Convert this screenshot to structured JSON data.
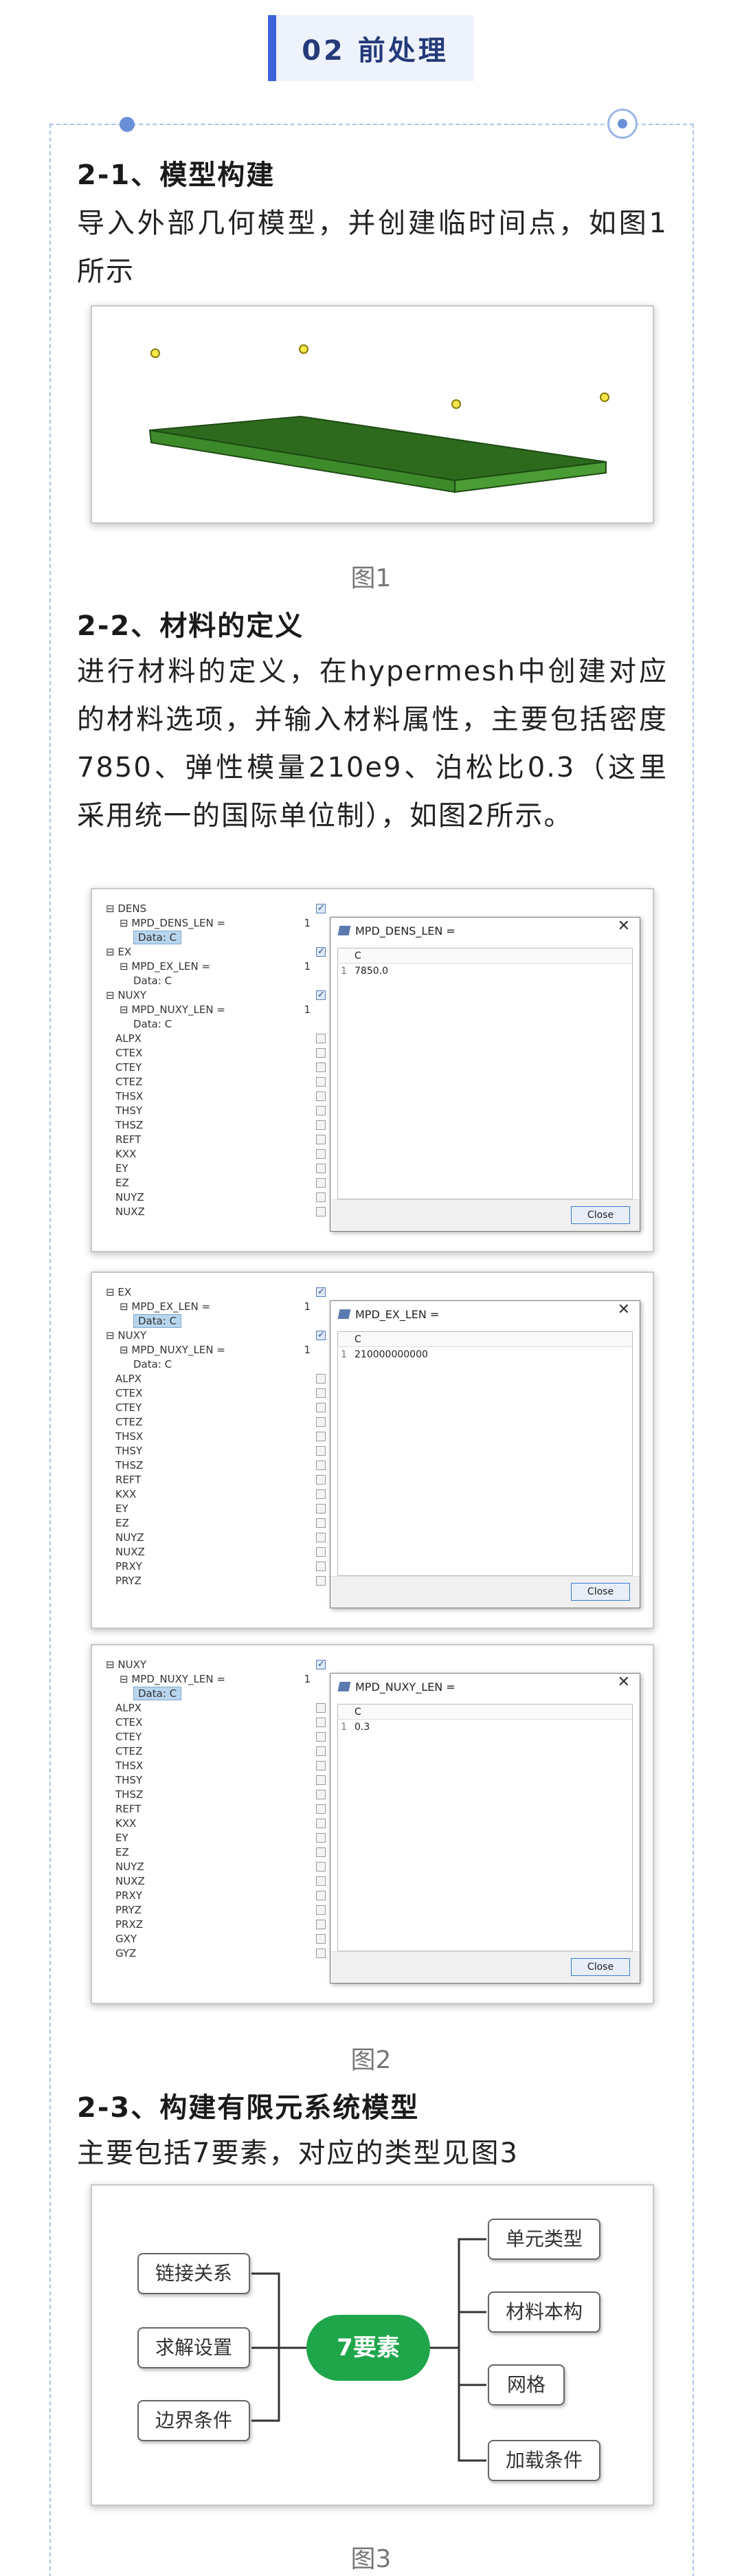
{
  "header": {
    "title": "02 前处理"
  },
  "sections": [
    {
      "heading": "2-1、模型构建",
      "text": "导入外部几何模型，并创建临时间点，如图1所示"
    },
    {
      "heading": "2-2、材料的定义",
      "text": "进行材料的定义，在hypermesh中创建对应的材料选项，并输入材料属性，主要包括密度7850、弹性模量210e9、泊松比0.3（这里采用统一的国际单位制），如图2所示。"
    },
    {
      "heading": "2-3、构建有限元系统模型",
      "text": "主要包括7要素，对应的类型见图3"
    }
  ],
  "captions": {
    "fig1": "图1",
    "fig2": "图2",
    "fig3": "图3"
  },
  "fig2": {
    "panels": [
      {
        "tree": [
          {
            "label": "DENS",
            "indent": 0,
            "exp": "⊟",
            "check": true
          },
          {
            "label": "MPD_DENS_LEN =",
            "indent": 1,
            "exp": "⊟",
            "val": "1"
          },
          {
            "label": "Data: C",
            "indent": 2,
            "sel": true
          },
          {
            "label": "EX",
            "indent": 0,
            "exp": "⊟",
            "check": true
          },
          {
            "label": "MPD_EX_LEN =",
            "indent": 1,
            "exp": "⊟",
            "val": "1"
          },
          {
            "label": "Data: C",
            "indent": 2
          },
          {
            "label": "NUXY",
            "indent": 0,
            "exp": "⊟",
            "check": true
          },
          {
            "label": "MPD_NUXY_LEN =",
            "indent": 1,
            "exp": "⊟",
            "val": "1"
          },
          {
            "label": "Data: C",
            "indent": 2
          },
          {
            "label": "ALPX",
            "indent": 0,
            "check": false
          },
          {
            "label": "CTEX",
            "indent": 0,
            "check": false
          },
          {
            "label": "CTEY",
            "indent": 0,
            "check": false
          },
          {
            "label": "CTEZ",
            "indent": 0,
            "check": false
          },
          {
            "label": "THSX",
            "indent": 0,
            "check": false
          },
          {
            "label": "THSY",
            "indent": 0,
            "check": false
          },
          {
            "label": "THSZ",
            "indent": 0,
            "check": false
          },
          {
            "label": "REFT",
            "indent": 0,
            "check": false
          },
          {
            "label": "KXX",
            "indent": 0,
            "check": false
          },
          {
            "label": "EY",
            "indent": 0,
            "check": false
          },
          {
            "label": "EZ",
            "indent": 0,
            "check": false
          },
          {
            "label": "NUYZ",
            "indent": 0,
            "check": false
          },
          {
            "label": "NUXZ",
            "indent": 0,
            "check": false
          }
        ],
        "dialog": {
          "title": "MPD_DENS_LEN =",
          "col": "C",
          "row_index": "1",
          "value": "7850.0",
          "close": "Close"
        }
      },
      {
        "tree": [
          {
            "label": "EX",
            "indent": 0,
            "exp": "⊟",
            "check": true
          },
          {
            "label": "MPD_EX_LEN =",
            "indent": 1,
            "exp": "⊟",
            "val": "1"
          },
          {
            "label": "Data: C",
            "indent": 2,
            "sel": true
          },
          {
            "label": "NUXY",
            "indent": 0,
            "exp": "⊟",
            "check": true
          },
          {
            "label": "MPD_NUXY_LEN =",
            "indent": 1,
            "exp": "⊟",
            "val": "1"
          },
          {
            "label": "Data: C",
            "indent": 2
          },
          {
            "label": "ALPX",
            "indent": 0,
            "check": false
          },
          {
            "label": "CTEX",
            "indent": 0,
            "check": false
          },
          {
            "label": "CTEY",
            "indent": 0,
            "check": false
          },
          {
            "label": "CTEZ",
            "indent": 0,
            "check": false
          },
          {
            "label": "THSX",
            "indent": 0,
            "check": false
          },
          {
            "label": "THSY",
            "indent": 0,
            "check": false
          },
          {
            "label": "THSZ",
            "indent": 0,
            "check": false
          },
          {
            "label": "REFT",
            "indent": 0,
            "check": false
          },
          {
            "label": "KXX",
            "indent": 0,
            "check": false
          },
          {
            "label": "EY",
            "indent": 0,
            "check": false
          },
          {
            "label": "EZ",
            "indent": 0,
            "check": false
          },
          {
            "label": "NUYZ",
            "indent": 0,
            "check": false
          },
          {
            "label": "NUXZ",
            "indent": 0,
            "check": false
          },
          {
            "label": "PRXY",
            "indent": 0,
            "check": false
          },
          {
            "label": "PRYZ",
            "indent": 0,
            "check": false
          }
        ],
        "dialog": {
          "title": "MPD_EX_LEN =",
          "col": "C",
          "row_index": "1",
          "value": "210000000000",
          "close": "Close"
        }
      },
      {
        "tree": [
          {
            "label": "NUXY",
            "indent": 0,
            "exp": "⊟",
            "check": true
          },
          {
            "label": "MPD_NUXY_LEN =",
            "indent": 1,
            "exp": "⊟",
            "val": "1"
          },
          {
            "label": "Data: C",
            "indent": 2,
            "sel": true
          },
          {
            "label": "ALPX",
            "indent": 0,
            "check": false
          },
          {
            "label": "CTEX",
            "indent": 0,
            "check": false
          },
          {
            "label": "CTEY",
            "indent": 0,
            "check": false
          },
          {
            "label": "CTEZ",
            "indent": 0,
            "check": false
          },
          {
            "label": "THSX",
            "indent": 0,
            "check": false
          },
          {
            "label": "THSY",
            "indent": 0,
            "check": false
          },
          {
            "label": "THSZ",
            "indent": 0,
            "check": false
          },
          {
            "label": "REFT",
            "indent": 0,
            "check": false
          },
          {
            "label": "KXX",
            "indent": 0,
            "check": false
          },
          {
            "label": "EY",
            "indent": 0,
            "check": false
          },
          {
            "label": "EZ",
            "indent": 0,
            "check": false
          },
          {
            "label": "NUYZ",
            "indent": 0,
            "check": false
          },
          {
            "label": "NUXZ",
            "indent": 0,
            "check": false
          },
          {
            "label": "PRXY",
            "indent": 0,
            "check": false
          },
          {
            "label": "PRYZ",
            "indent": 0,
            "check": false
          },
          {
            "label": "PRXZ",
            "indent": 0,
            "check": false
          },
          {
            "label": "GXY",
            "indent": 0,
            "check": false
          },
          {
            "label": "GYZ",
            "indent": 0,
            "check": false
          }
        ],
        "dialog": {
          "title": "MPD_NUXY_LEN =",
          "col": "C",
          "row_index": "1",
          "value": "0.3",
          "close": "Close"
        }
      }
    ]
  },
  "fig3": {
    "center": "7要素",
    "left": [
      "链接关系",
      "求解设置",
      "边界条件"
    ],
    "right": [
      "单元类型",
      "材料本构",
      "网格",
      "加载条件"
    ],
    "center_color": "#1fa64a"
  }
}
